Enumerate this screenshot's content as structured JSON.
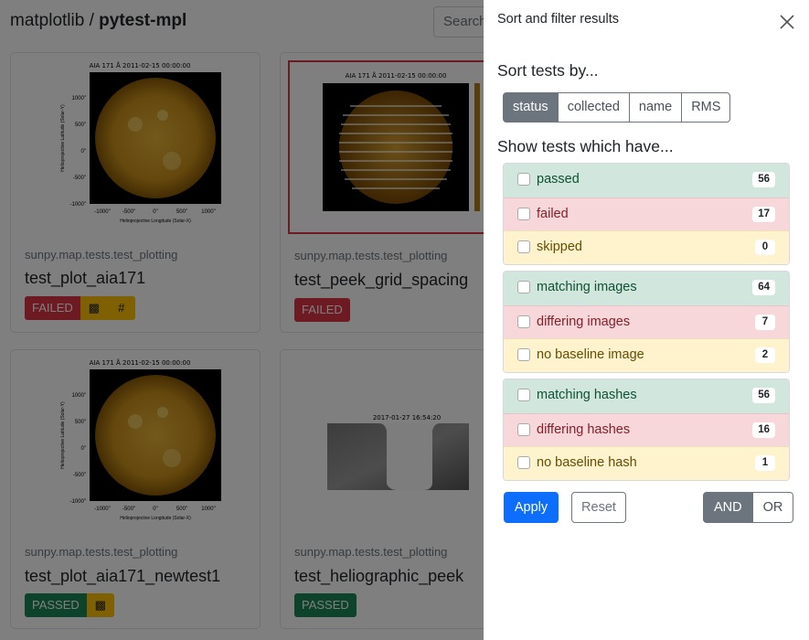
{
  "background": {
    "brand_prefix": "matplotlib / ",
    "brand_strong": "pytest-mpl",
    "search_placeholder": "Search",
    "cards": [
      {
        "module": "sunpy.map.tests.test_plotting",
        "name": "test_plot_aia171",
        "status": "FAILED",
        "image_title": "AIA 171 Å 2011-02-15 00:00:00",
        "hash_label": "#"
      },
      {
        "module": "sunpy.map.tests.test_plotting",
        "name": "test_peek_grid_spacing",
        "status": "FAILED",
        "image_title": "AIA 171 Å 2011-02-15 00:00:00"
      },
      {
        "module": "sunpy.map.tests.test_plotting",
        "name": "test_plot_aia171_newtest1",
        "status": "PASSED",
        "image_title": "AIA 171 Å 2011-02-15 00:00:00"
      },
      {
        "module": "sunpy.map.tests.test_plotting",
        "name": "test_heliographic_peek",
        "status": "PASSED",
        "image_title": "2017-01-27 16:54:20"
      }
    ],
    "axis": {
      "y_ticks": [
        "1000\"",
        "500\"",
        "0\"",
        "-500\"",
        "-1000\""
      ],
      "x_ticks": [
        "-1000\"",
        "-500\"",
        "0\"",
        "500\"",
        "1000\""
      ],
      "ylabel": "Helioprojective Latitude (Solar-Y)",
      "xlabel": "Helioprojective Longitude (Solar-X)"
    }
  },
  "panel": {
    "title": "Sort and filter results",
    "sort_heading": "Sort tests by...",
    "sort_options": [
      "status",
      "collected",
      "name",
      "RMS"
    ],
    "sort_active": "status",
    "filter_heading": "Show tests which have...",
    "groups": [
      [
        {
          "label": "passed",
          "count": "56",
          "tone": "success"
        },
        {
          "label": "failed",
          "count": "17",
          "tone": "danger"
        },
        {
          "label": "skipped",
          "count": "0",
          "tone": "warning"
        }
      ],
      [
        {
          "label": "matching images",
          "count": "64",
          "tone": "success"
        },
        {
          "label": "differing images",
          "count": "7",
          "tone": "danger"
        },
        {
          "label": "no baseline image",
          "count": "2",
          "tone": "warning"
        }
      ],
      [
        {
          "label": "matching hashes",
          "count": "56",
          "tone": "success"
        },
        {
          "label": "differing hashes",
          "count": "16",
          "tone": "danger"
        },
        {
          "label": "no baseline hash",
          "count": "1",
          "tone": "warning"
        }
      ]
    ],
    "apply_label": "Apply",
    "reset_label": "Reset",
    "logic_options": [
      "AND",
      "OR"
    ],
    "logic_active": "AND"
  },
  "colors": {
    "primary": "#0d6efd",
    "secondary": "#6c757d",
    "success_bg": "#d1e7dd",
    "danger_bg": "#f8d7da",
    "warning_bg": "#fff3cd",
    "failed_badge": "#dc3545",
    "passed_badge": "#198754"
  }
}
